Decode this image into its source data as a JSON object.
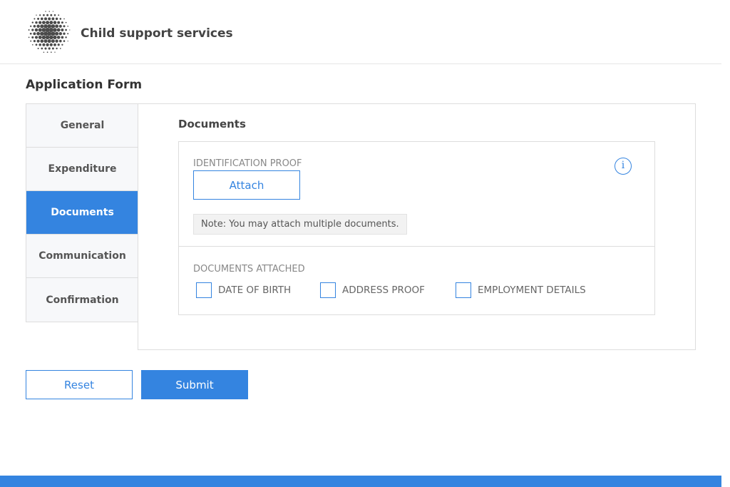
{
  "header": {
    "logo_icon": "dotted-sphere-logo",
    "app_title": "Child support services"
  },
  "page": {
    "title": "Application Form"
  },
  "sidebar": {
    "items": [
      {
        "label": "General",
        "active": false
      },
      {
        "label": "Expenditure",
        "active": false
      },
      {
        "label": "Documents",
        "active": true
      },
      {
        "label": "Communication",
        "active": false
      },
      {
        "label": "Confirmation",
        "active": false
      }
    ]
  },
  "documents": {
    "section_title": "Documents",
    "identification_label": "IDENTIFICATION PROOF",
    "attach_label": "Attach",
    "info_icon": "info-icon",
    "note": "Note: You may attach multiple documents.",
    "attached_label": "DOCUMENTS ATTACHED",
    "checkboxes": [
      {
        "label": "DATE OF BIRTH",
        "checked": false
      },
      {
        "label": "ADDRESS PROOF",
        "checked": false
      },
      {
        "label": "EMPLOYMENT DETAILS",
        "checked": false
      }
    ]
  },
  "actions": {
    "reset_label": "Reset",
    "submit_label": "Submit"
  },
  "colors": {
    "accent": "#3484e0",
    "sidebar_bg": "#f7f8fa",
    "border": "#dddddd"
  }
}
